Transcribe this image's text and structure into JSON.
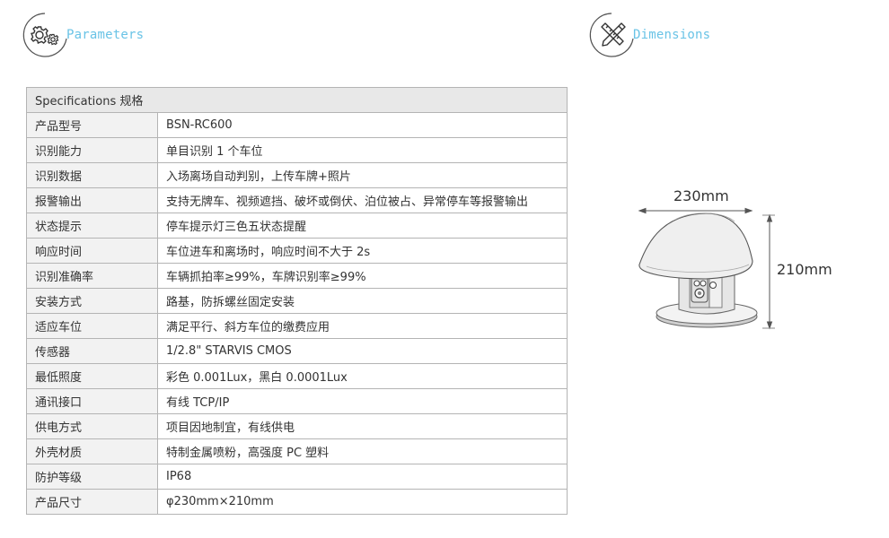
{
  "sections": {
    "parameters_label": "Parameters",
    "dimensions_label": "Dimensions"
  },
  "table": {
    "header": "Specifications  规格",
    "rows": [
      {
        "key": "产品型号",
        "value": "BSN-RC600"
      },
      {
        "key": "识别能力",
        "value": "单目识别 1 个车位"
      },
      {
        "key": "识别数据",
        "value": "入场离场自动判别，上传车牌+照片"
      },
      {
        "key": "报警输出",
        "value": "支持无牌车、视频遮挡、破坏或倒伏、泊位被占、异常停车等报警输出"
      },
      {
        "key": "状态提示",
        "value": "停车提示灯三色五状态提醒"
      },
      {
        "key": "响应时间",
        "value": "车位进车和离场时，响应时间不大于 2s"
      },
      {
        "key": "识别准确率",
        "value": "车辆抓拍率≥99%，车牌识别率≥99%"
      },
      {
        "key": "安装方式",
        "value": "路基，防拆螺丝固定安装"
      },
      {
        "key": "适应车位",
        "value": "满足平行、斜方车位的缴费应用"
      },
      {
        "key": "传感器",
        "value": "1/2.8\" STARVIS CMOS"
      },
      {
        "key": "最低照度",
        "value": "彩色 0.001Lux，黑白 0.0001Lux"
      },
      {
        "key": "通讯接口",
        "value": "有线 TCP/IP"
      },
      {
        "key": "供电方式",
        "value": "项目因地制宜，有线供电"
      },
      {
        "key": "外壳材质",
        "value": "特制金属喷粉，高强度 PC 塑料"
      },
      {
        "key": "防护等级",
        "value": "IP68"
      },
      {
        "key": "产品尺寸",
        "value": "φ230mm×210mm"
      }
    ]
  },
  "dimensions": {
    "width_label": "230mm",
    "height_label": "210mm"
  },
  "icons": {
    "parameters": "gears-icon",
    "dimensions": "ruler-pencil-icon"
  },
  "colors": {
    "accent": "#69c3e6",
    "table_header_bg": "#e8e8e8",
    "table_key_bg": "#f2f2f2",
    "border": "#b4b4b4"
  }
}
